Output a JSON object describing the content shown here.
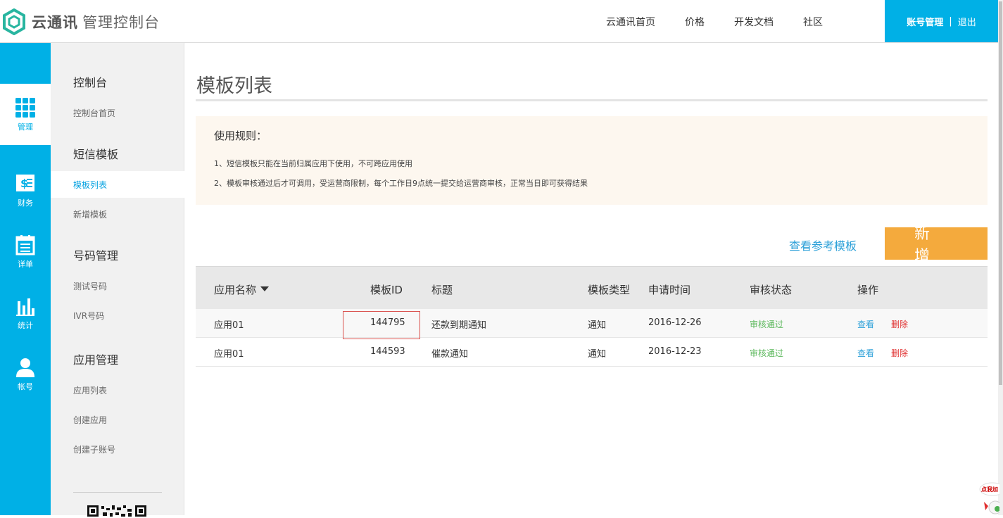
{
  "header": {
    "brand": "云通讯",
    "subtitle": "管理控制台",
    "nav": [
      "云通讯首页",
      "价格",
      "开发文档",
      "社区"
    ],
    "account_label": "账号管理",
    "separator": "|",
    "logout_label": "退出"
  },
  "rail": [
    {
      "label": "管理",
      "icon": "grid-icon",
      "active": true
    },
    {
      "label": "财务",
      "icon": "finance-icon",
      "active": false
    },
    {
      "label": "详单",
      "icon": "calendar-list-icon",
      "active": false
    },
    {
      "label": "统计",
      "icon": "bar-chart-icon",
      "active": false
    },
    {
      "label": "帐号",
      "icon": "user-icon",
      "active": false
    }
  ],
  "sidebar": {
    "sections": [
      {
        "title": "控制台",
        "items": [
          "控制台首页"
        ]
      },
      {
        "title": "短信模板",
        "items": [
          "模板列表",
          "新增模板"
        ]
      },
      {
        "title": "号码管理",
        "items": [
          "测试号码",
          "IVR号码"
        ]
      },
      {
        "title": "应用管理",
        "items": [
          "应用列表",
          "创建应用",
          "创建子账号"
        ]
      }
    ],
    "active_item": "模板列表"
  },
  "main": {
    "title": "模板列表",
    "rules": {
      "title": "使用规则：",
      "items": [
        "1、短信模板只能在当前归属应用下使用，不可跨应用使用",
        "2、模板审核通过后才可调用，受运营商限制，每个工作日9点统一提交给运营商审核，正常当日即可获得结果"
      ]
    },
    "ref_link": "查看参考模板",
    "add_button": "新增"
  },
  "table": {
    "columns": [
      "应用名称",
      "模板ID",
      "标题",
      "模板类型",
      "申请时间",
      "审核状态",
      "操作"
    ],
    "rows": [
      {
        "app": "应用01",
        "id": "144795",
        "title": "还款到期通知",
        "type": "通知",
        "date": "2016-12-26",
        "status": "审核通过",
        "view": "查看",
        "delete": "删除"
      },
      {
        "app": "应用01",
        "id": "144593",
        "title": "催款通知",
        "type": "通知",
        "date": "2016-12-23",
        "status": "审核通过",
        "view": "查看",
        "delete": "删除"
      }
    ]
  },
  "promo": "点我加",
  "colors": {
    "primary": "#00b0e6",
    "accent": "#f4aa3d",
    "success": "#5cb85c",
    "danger": "#e03030",
    "link": "#2a9fd8"
  }
}
